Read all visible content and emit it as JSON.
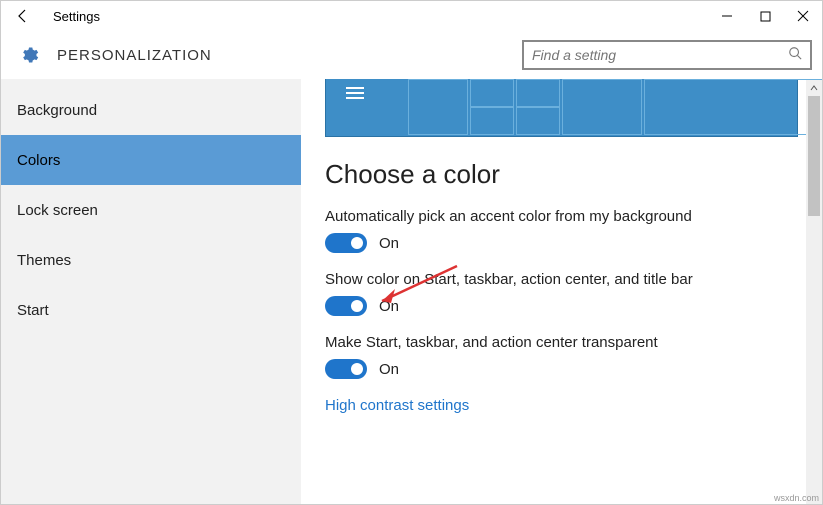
{
  "titlebar": {
    "title": "Settings"
  },
  "header": {
    "page_title": "PERSONALIZATION",
    "search_placeholder": "Find a setting"
  },
  "sidebar": {
    "items": [
      {
        "label": "Background"
      },
      {
        "label": "Colors"
      },
      {
        "label": "Lock screen"
      },
      {
        "label": "Themes"
      },
      {
        "label": "Start"
      }
    ],
    "selected_index": 1
  },
  "content": {
    "section_title": "Choose a color",
    "options": [
      {
        "label": "Automatically pick an accent color from my background",
        "state": "On"
      },
      {
        "label": "Show color on Start, taskbar, action center, and title bar",
        "state": "On"
      },
      {
        "label": "Make Start, taskbar, and action center transparent",
        "state": "On"
      }
    ],
    "link": "High contrast settings"
  },
  "watermark": "wsxdn.com"
}
